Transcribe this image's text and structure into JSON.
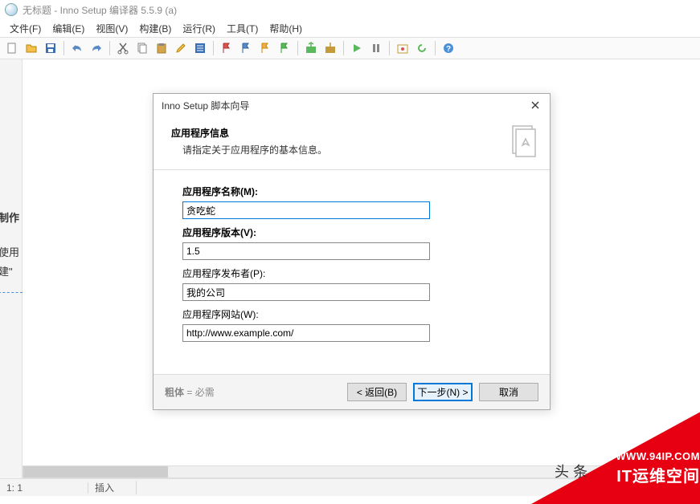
{
  "window": {
    "title": "无标题 - Inno Setup 编译器 5.5.9 (a)"
  },
  "menu": {
    "file": "文件(F)",
    "edit": "编辑(E)",
    "view": "视图(V)",
    "build": "构建(B)",
    "run": "运行(R)",
    "tools": "工具(T)",
    "help": "帮助(H)"
  },
  "dialog": {
    "title": "Inno Setup 脚本向导",
    "header_title": "应用程序信息",
    "header_sub": "请指定关于应用程序的基本信息。",
    "fields": {
      "name_label": "应用程序名称(M):",
      "name_value": "贪吃蛇",
      "version_label": "应用程序版本(V):",
      "version_value": "1.5",
      "publisher_label": "应用程序发布者(P):",
      "publisher_value": "我的公司",
      "website_label": "应用程序网站(W):",
      "website_value": "http://www.example.com/"
    },
    "footer_bold": "粗体",
    "footer_note": " = 必需",
    "btn_back": "< 返回(B)",
    "btn_next": "下一步(N) >",
    "btn_cancel": "取消"
  },
  "status": {
    "pos": "1:   1",
    "mode": "插入"
  },
  "left_hints": {
    "l1": "制作",
    "l2": "使用",
    "l3": "建\""
  },
  "watermark": {
    "url": "WWW.94IP.COM",
    "text": "IT运维空间",
    "head": "头 条"
  }
}
